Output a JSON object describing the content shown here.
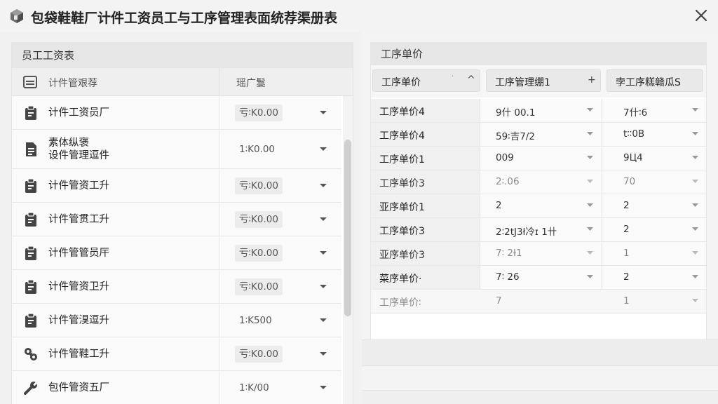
{
  "window": {
    "title": "包袋鞋鞋厂计件工资员工与工序管理表面统荐渠册表",
    "app_icon": "box-cube-icon",
    "close_icon": "close-icon"
  },
  "left_panel": {
    "title": "员工工资表",
    "list_header": {
      "icon": "list-icon",
      "name": "计件管艰荐",
      "value": "瑶广䯹"
    },
    "rows": [
      {
        "icon": "clipboard-icon",
        "name": "计件工资员厂",
        "value": "亏∶K0.00"
      },
      {
        "icon": "document-icon",
        "name": "素体纵褒\n设件管理逗件",
        "value": "1∶K0.00"
      },
      {
        "icon": "clipboard-icon",
        "name": "计件管资工升",
        "value": "亏∶K0.00"
      },
      {
        "icon": "clipboard-icon",
        "name": "计件管贯工升",
        "value": "亏∶K0.00"
      },
      {
        "icon": "clipboard-icon",
        "name": "计件管管员厈",
        "value": "亏∶K0.00"
      },
      {
        "icon": "clipboard-icon",
        "name": "计件管资卫升",
        "value": "亏∶K0.00"
      },
      {
        "icon": "clipboard-icon",
        "name": "计件管湨逗升",
        "value": "1∶K500"
      },
      {
        "icon": "gear-wrench-icon",
        "name": "计件管鞋工升",
        "value": "亏∶K0.00"
      },
      {
        "icon": "wrench-icon",
        "name": "包件管资五厂",
        "value": "1∶K/00"
      }
    ]
  },
  "right_panel": {
    "title": "工序单价",
    "filters": [
      {
        "label": "工序单价",
        "glyph": "^"
      },
      {
        "label": "工序管理绷1",
        "glyph": "+"
      },
      {
        "label": "孛工序糕赣瓜S",
        "glyph": ""
      }
    ],
    "rows": [
      {
        "name": "工序单价4",
        "col2": "9什 00.1",
        "col3": "7什∶6"
      },
      {
        "name": "工序单价4",
        "col2": "59∶吉7/2",
        "col3": "t∶∶0B"
      },
      {
        "name": "工序单价1",
        "col2": "009",
        "col3": "9Ц4"
      },
      {
        "name": "工序单价3",
        "col2": "2∶.06",
        "col3": "70"
      },
      {
        "name": "亚序单价1",
        "col2": "2",
        "col3": "2"
      },
      {
        "name": "工序单价3",
        "col2": "2∶2tJ3ł冷ɪ 1卄",
        "col3": "2"
      },
      {
        "name": "亚序单价3",
        "col2": "7∶ 2Ɨ1",
        "col3": "1"
      },
      {
        "name": "菜序单价·",
        "col2": "7∶ 26",
        "col3": "2"
      },
      {
        "name": "工序单价∶",
        "col2": "7",
        "col3": "1"
      }
    ]
  }
}
